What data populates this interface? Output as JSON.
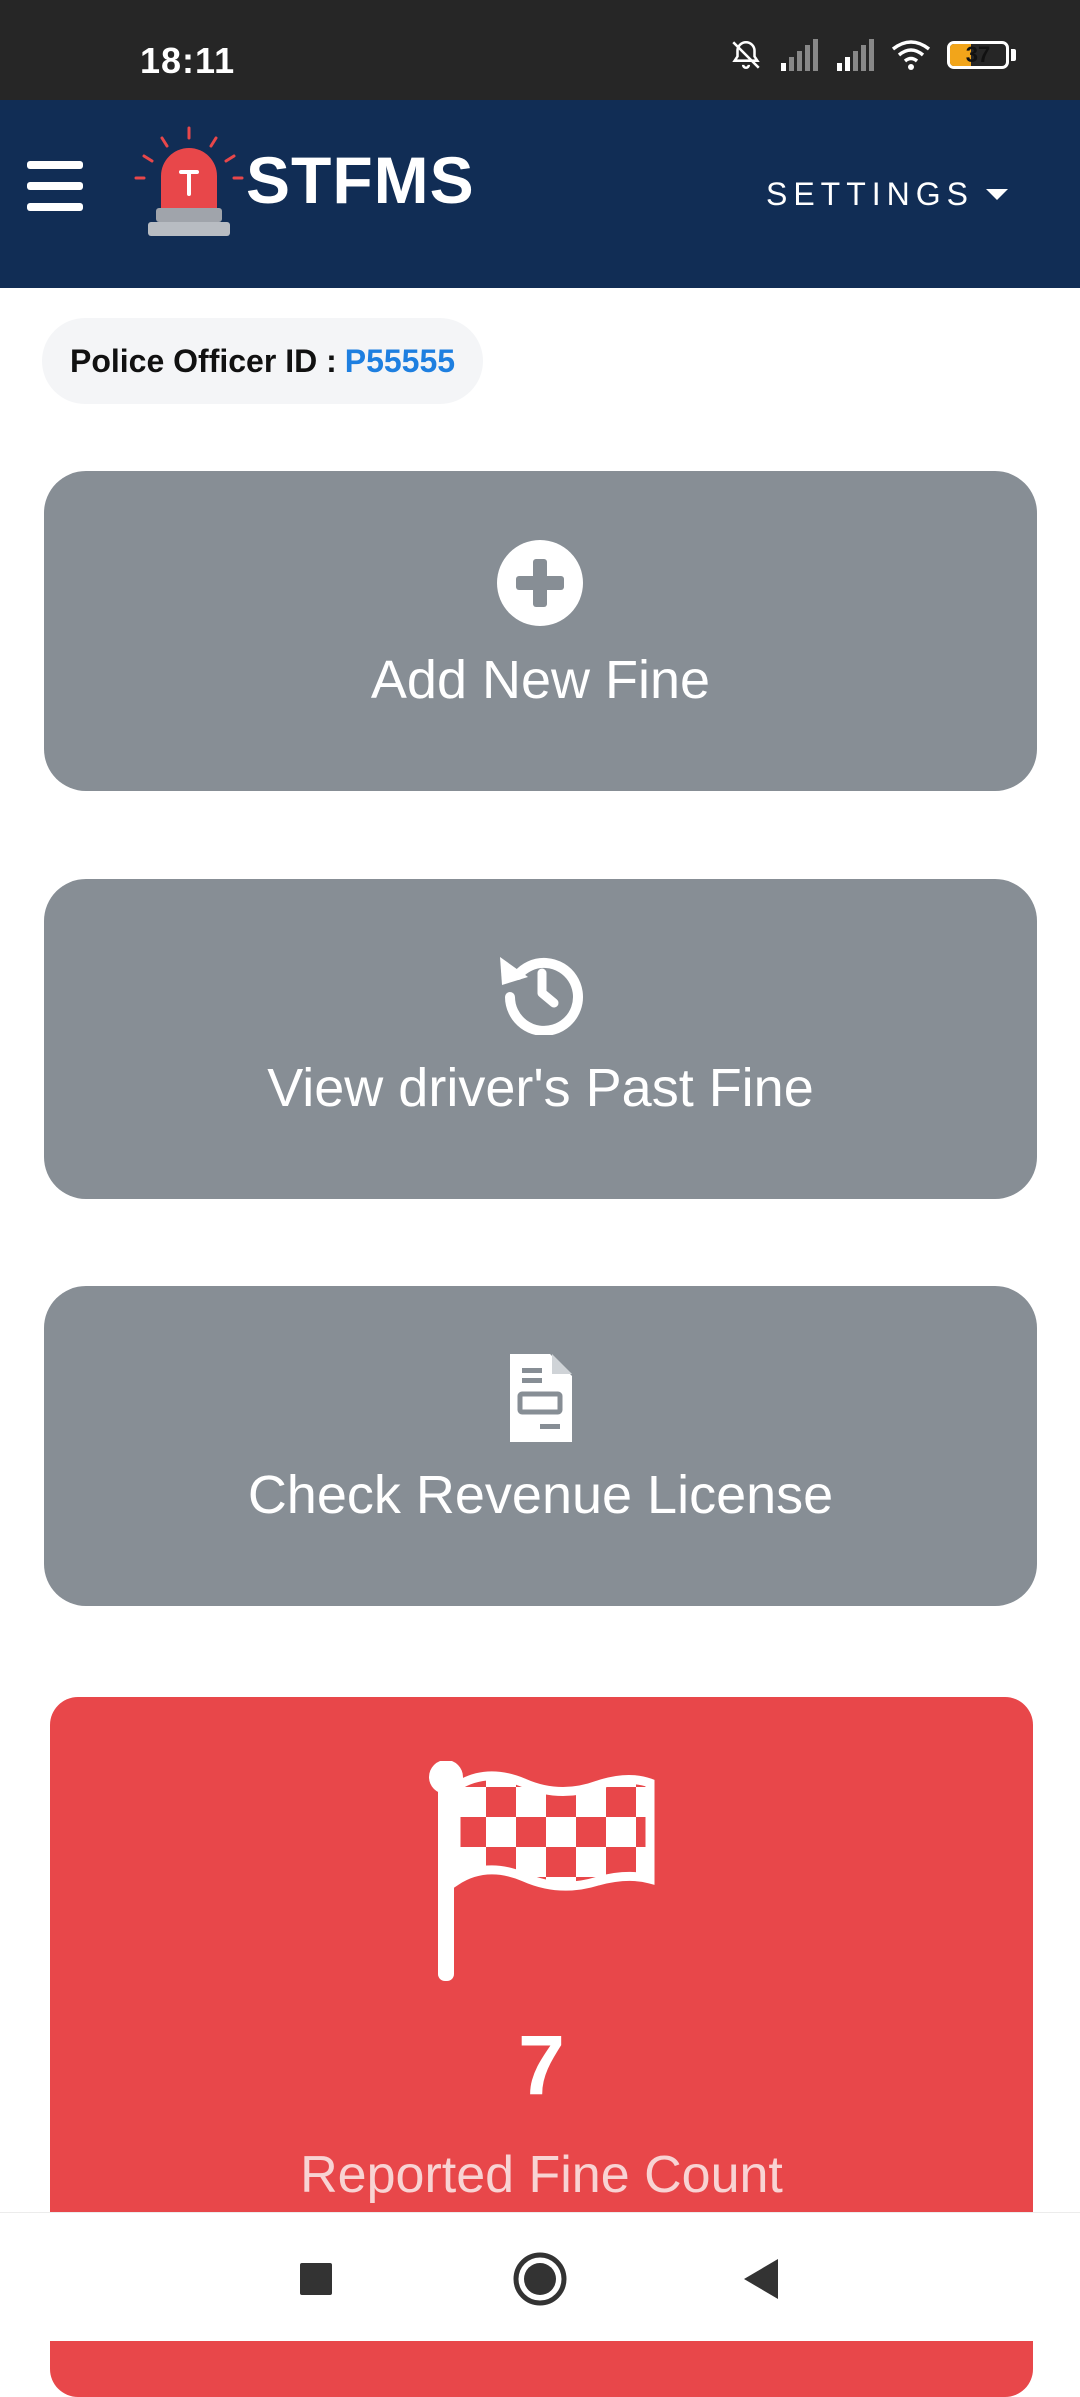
{
  "status_bar": {
    "time": "18:11",
    "battery_percent": "37",
    "icons": [
      "bell-off-icon",
      "signal-icon",
      "signal-icon",
      "wifi-icon",
      "battery-icon"
    ]
  },
  "header": {
    "brand": "STFMS",
    "settings_label": "SETTINGS",
    "menu_icon": "hamburger-icon",
    "logo_icon": "siren-icon",
    "background_color": "#112d55"
  },
  "officer": {
    "label": "Police Officer ID :",
    "id": "P55555",
    "id_color": "#1e7fe0"
  },
  "actions": [
    {
      "label": "Add New Fine",
      "icon": "plus-circle-icon"
    },
    {
      "label": "View driver's Past Fine",
      "icon": "history-icon"
    },
    {
      "label": "Check Revenue License",
      "icon": "document-icon"
    }
  ],
  "stat": {
    "count": "7",
    "caption": "Reported Fine Count",
    "icon": "checkered-flag-icon",
    "color": "#e8474a"
  },
  "nav": {
    "icons": [
      "recent-apps-icon",
      "home-icon",
      "back-icon"
    ]
  }
}
